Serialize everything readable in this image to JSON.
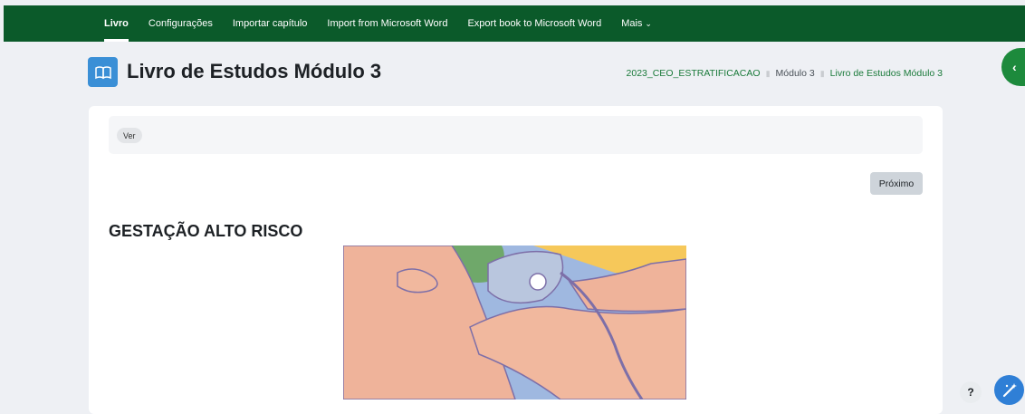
{
  "nav": {
    "items": [
      {
        "label": "Livro",
        "active": true
      },
      {
        "label": "Configurações"
      },
      {
        "label": "Importar capítulo"
      },
      {
        "label": "Import from Microsoft Word"
      },
      {
        "label": "Export book to Microsoft Word"
      },
      {
        "label": "Mais"
      }
    ],
    "more_icon": "chevron-down-icon"
  },
  "header": {
    "title": "Livro de Estudos Módulo 3",
    "icon": "book-icon",
    "breadcrumb": [
      "2023_CEO_ESTRATIFICACAO",
      "Módulo 3",
      "Livro de Estudos Módulo 3"
    ]
  },
  "tertiary": {
    "ver_label": "Ver"
  },
  "content": {
    "next_label": "Próximo",
    "chapter_title": "GESTAÇÃO ALTO RISCO"
  },
  "floating": {
    "help_label": "?",
    "drawer_icon": "chevron-left-icon",
    "magic_icon": "magic-wand-icon"
  },
  "colors": {
    "nav_bg": "#0b5a2a",
    "accent": "#1d8a3c",
    "link": "#1a7a3a",
    "title_icon_bg": "#3a8fd6"
  }
}
